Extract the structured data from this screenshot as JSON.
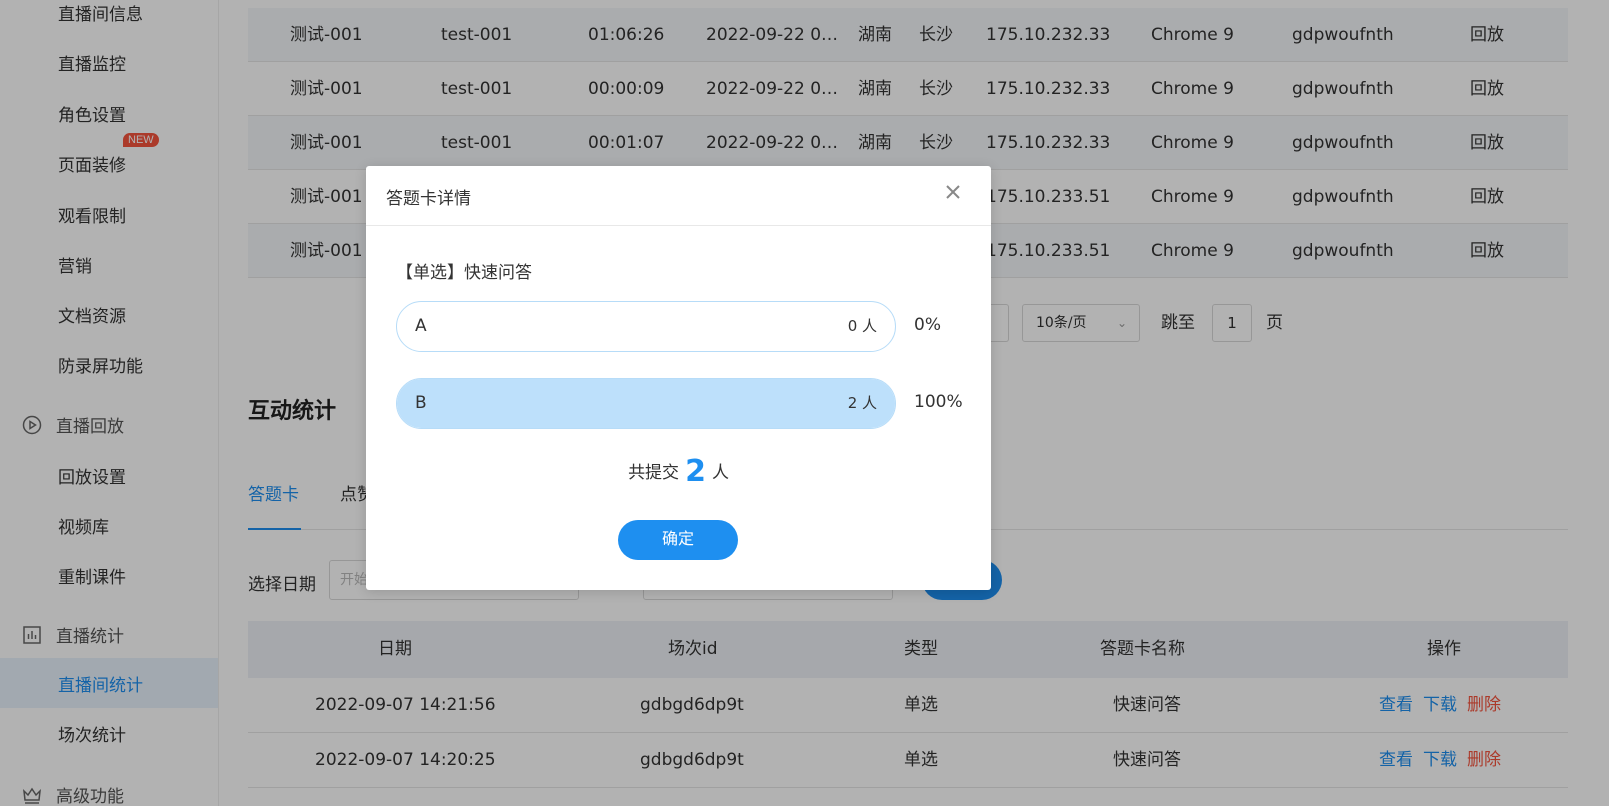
{
  "sidebar": {
    "items_top": [
      "直播间信息",
      "直播监控",
      "角色设置",
      "页面装修",
      "观看限制",
      "营销",
      "文档资源",
      "防录屏功能"
    ],
    "new_badge": "NEW",
    "group_replay": "直播回放",
    "items_replay": [
      "回放设置",
      "视频库",
      "重制课件"
    ],
    "group_stats": "直播统计",
    "items_stats": [
      "直播间统计",
      "场次统计"
    ],
    "group_advanced": "高级功能"
  },
  "viewer_table": {
    "rows": [
      [
        "测试-001",
        "test-001",
        "01:06:26",
        "2022-09-22 0…",
        "湖南",
        "长沙",
        "175.10.232.33",
        "Chrome 9",
        "gdpwoufnth",
        "回放"
      ],
      [
        "测试-001",
        "test-001",
        "00:00:09",
        "2022-09-22 0…",
        "湖南",
        "长沙",
        "175.10.232.33",
        "Chrome 9",
        "gdpwoufnth",
        "回放"
      ],
      [
        "测试-001",
        "test-001",
        "00:01:07",
        "2022-09-22 0…",
        "湖南",
        "长沙",
        "175.10.232.33",
        "Chrome 9",
        "gdpwoufnth",
        "回放"
      ],
      [
        "测试-001",
        "",
        "",
        "",
        "",
        "",
        "175.10.233.51",
        "Chrome 9",
        "gdpwoufnth",
        "回放"
      ],
      [
        "测试-001",
        "",
        "",
        "",
        "",
        "",
        "175.10.233.51",
        "Chrome 9",
        "gdpwoufnth",
        "回放"
      ]
    ]
  },
  "pager": {
    "page_size": "10条/页",
    "jump_label": "跳至",
    "jump_value": "1",
    "page_suffix": "页"
  },
  "interaction": {
    "title": "互动统计",
    "tabs": [
      "答题卡",
      "点赞"
    ],
    "date_label": "选择日期",
    "date_start_placeholder": "开始"
  },
  "answer_table": {
    "headers": [
      "日期",
      "场次id",
      "类型",
      "答题卡名称",
      "操作"
    ],
    "rows": [
      {
        "date": "2022-09-07 14:21:56",
        "session": "gdbgd6dp9t",
        "type": "单选",
        "name": "快速问答"
      },
      {
        "date": "2022-09-07 14:20:25",
        "session": "gdbgd6dp9t",
        "type": "单选",
        "name": "快速问答"
      }
    ],
    "actions": {
      "view": "查看",
      "download": "下载",
      "delete": "删除"
    }
  },
  "modal": {
    "title": "答题卡详情",
    "question": "【单选】快速问答",
    "options": [
      {
        "label": "A",
        "count": "0 人",
        "percent": "0%",
        "fraction": 0
      },
      {
        "label": "B",
        "count": "2 人",
        "percent": "100%",
        "fraction": 1
      }
    ],
    "summary_prefix": "共提交",
    "summary_count": "2",
    "summary_suffix": "人",
    "ok_label": "确定"
  },
  "colors": {
    "accent": "#1e8ff0",
    "danger": "#f5533d",
    "option_fill": "#bde0fb"
  }
}
